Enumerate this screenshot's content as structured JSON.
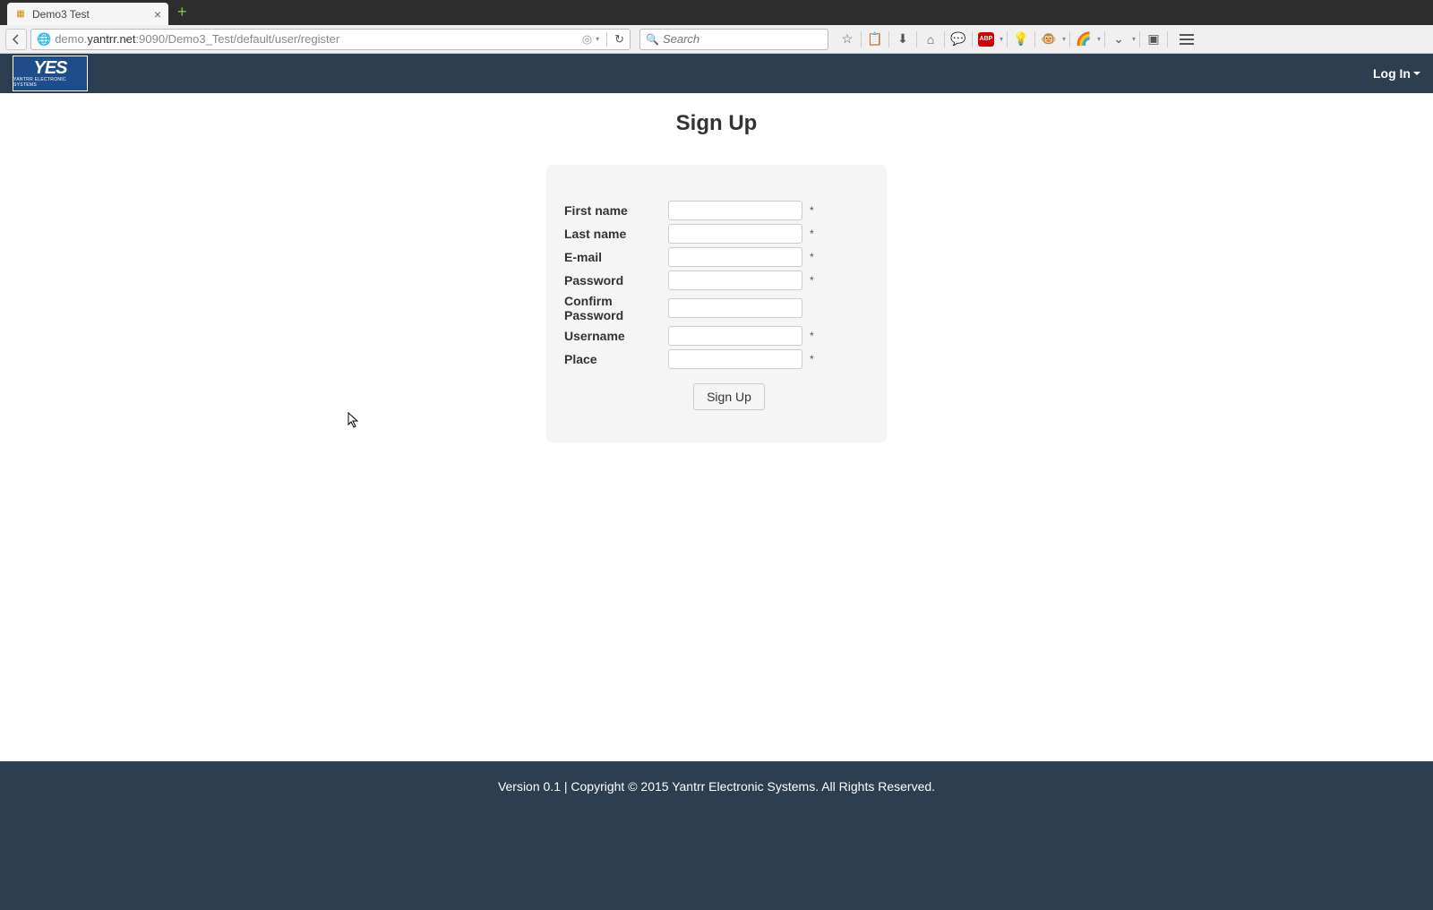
{
  "browser": {
    "tab_title": "Demo3 Test",
    "url_prefix": "demo.",
    "url_domain": "yantrr.net",
    "url_suffix": ":9090/Demo3_Test/default/user/register",
    "search_placeholder": "Search"
  },
  "header": {
    "logo_main": "YES",
    "logo_sub": "YANTRR ELECTRONIC SYSTEMS",
    "login": "Log In"
  },
  "page": {
    "title": "Sign Up"
  },
  "form": {
    "fields": [
      {
        "label": "First name",
        "required": "*"
      },
      {
        "label": "Last name",
        "required": "*"
      },
      {
        "label": "E-mail",
        "required": "*"
      },
      {
        "label": "Password",
        "required": "*"
      },
      {
        "label": "Confirm Password",
        "required": ""
      },
      {
        "label": "Username",
        "required": "*"
      },
      {
        "label": "Place",
        "required": "*"
      }
    ],
    "submit": "Sign Up"
  },
  "footer": {
    "text": "Version 0.1 | Copyright © 2015 Yantrr Electronic Systems. All Rights Reserved."
  }
}
